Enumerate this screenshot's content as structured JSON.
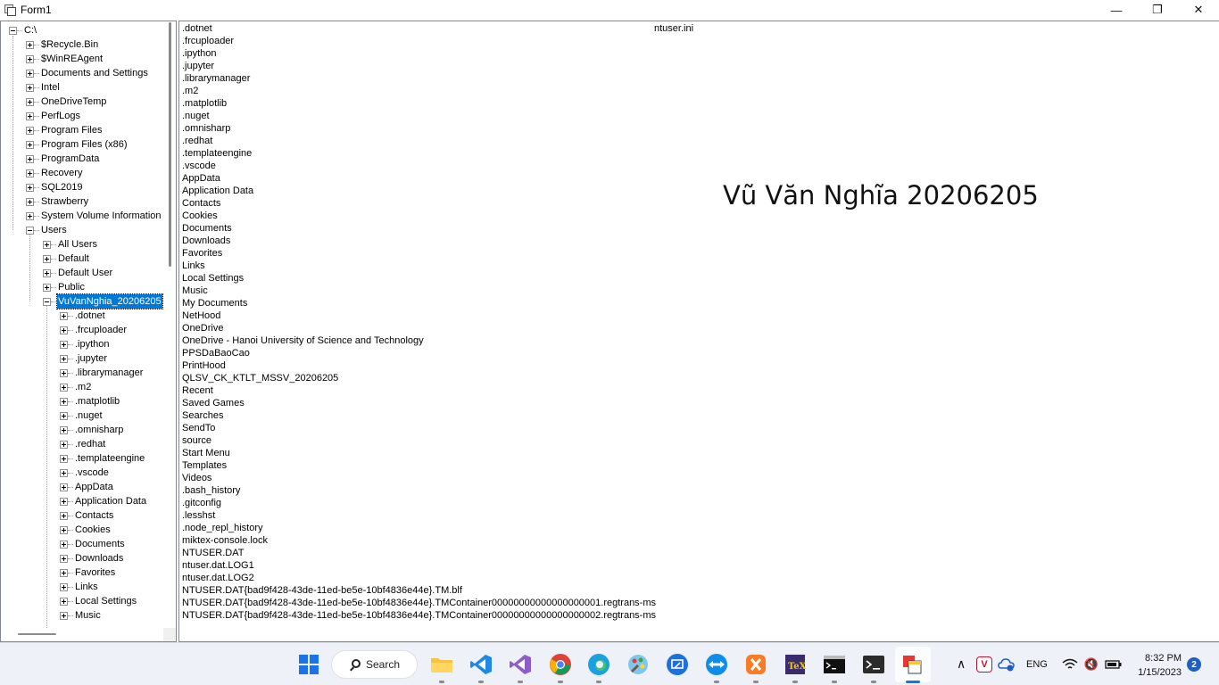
{
  "window": {
    "title": "Form1",
    "minimize": "—",
    "restore": "❐",
    "close": "✕"
  },
  "tree": {
    "root": "C:\\",
    "level1": [
      "$Recycle.Bin",
      "$WinREAgent",
      "Documents and Settings",
      "Intel",
      "OneDriveTemp",
      "PerfLogs",
      "Program Files",
      "Program Files (x86)",
      "ProgramData",
      "Recovery",
      "SQL2019",
      "Strawberry",
      "System Volume Information",
      "Users"
    ],
    "users_children": [
      "All Users",
      "Default",
      "Default User",
      "Public",
      "VuVanNghia_20206205"
    ],
    "selected": "VuVanNghia_20206205",
    "user_children": [
      ".dotnet",
      ".frcuploader",
      ".ipython",
      ".jupyter",
      ".librarymanager",
      ".m2",
      ".matplotlib",
      ".nuget",
      ".omnisharp",
      ".redhat",
      ".templateengine",
      ".vscode",
      "AppData",
      "Application Data",
      "Contacts",
      "Cookies",
      "Documents",
      "Downloads",
      "Favorites",
      "Links",
      "Local Settings",
      "Music"
    ]
  },
  "list": {
    "items": [
      ".dotnet",
      ".frcuploader",
      ".ipython",
      ".jupyter",
      ".librarymanager",
      ".m2",
      ".matplotlib",
      ".nuget",
      ".omnisharp",
      ".redhat",
      ".templateengine",
      ".vscode",
      "AppData",
      "Application Data",
      "Contacts",
      "Cookies",
      "Documents",
      "Downloads",
      "Favorites",
      "Links",
      "Local Settings",
      "Music",
      "My Documents",
      "NetHood",
      "OneDrive",
      "OneDrive - Hanoi University of Science and Technology",
      "PPSDaBaoCao",
      "PrintHood",
      "QLSV_CK_KTLT_MSSV_20206205",
      "Recent",
      "Saved Games",
      "Searches",
      "SendTo",
      "source",
      "Start Menu",
      "Templates",
      "Videos",
      ".bash_history",
      ".gitconfig",
      ".lesshst",
      ".node_repl_history",
      "miktex-console.lock",
      "NTUSER.DAT",
      "ntuser.dat.LOG1",
      "ntuser.dat.LOG2",
      "NTUSER.DAT{bad9f428-43de-11ed-be5e-10bf4836e44e}.TM.blf",
      "NTUSER.DAT{bad9f428-43de-11ed-be5e-10bf4836e44e}.TMContainer00000000000000000001.regtrans-ms",
      "NTUSER.DAT{bad9f428-43de-11ed-be5e-10bf4836e44e}.TMContainer00000000000000000002.regtrans-ms"
    ],
    "column2_items": [
      "ntuser.ini"
    ],
    "watermark": "Vũ Văn Nghĩa 20206205"
  },
  "taskbar": {
    "search_label": "Search",
    "apps": [
      "start-icon",
      "file-explorer-icon",
      "vscode-icon",
      "visual-studio-icon",
      "chrome-icon",
      "edge-icon",
      "paint-icon",
      "screen-recorder-icon",
      "teamviewer-icon",
      "xampp-icon",
      "texworks-icon",
      "command-prompt-icon",
      "terminal-icon",
      "form-app-icon"
    ],
    "tray_chevron": "∧",
    "language": "ENG",
    "time": "8:32 PM",
    "date": "1/15/2023",
    "notification_count": "2"
  },
  "colors": {
    "selection": "#0078d7",
    "border": "#828790",
    "taskbar": "#eef1f7"
  }
}
